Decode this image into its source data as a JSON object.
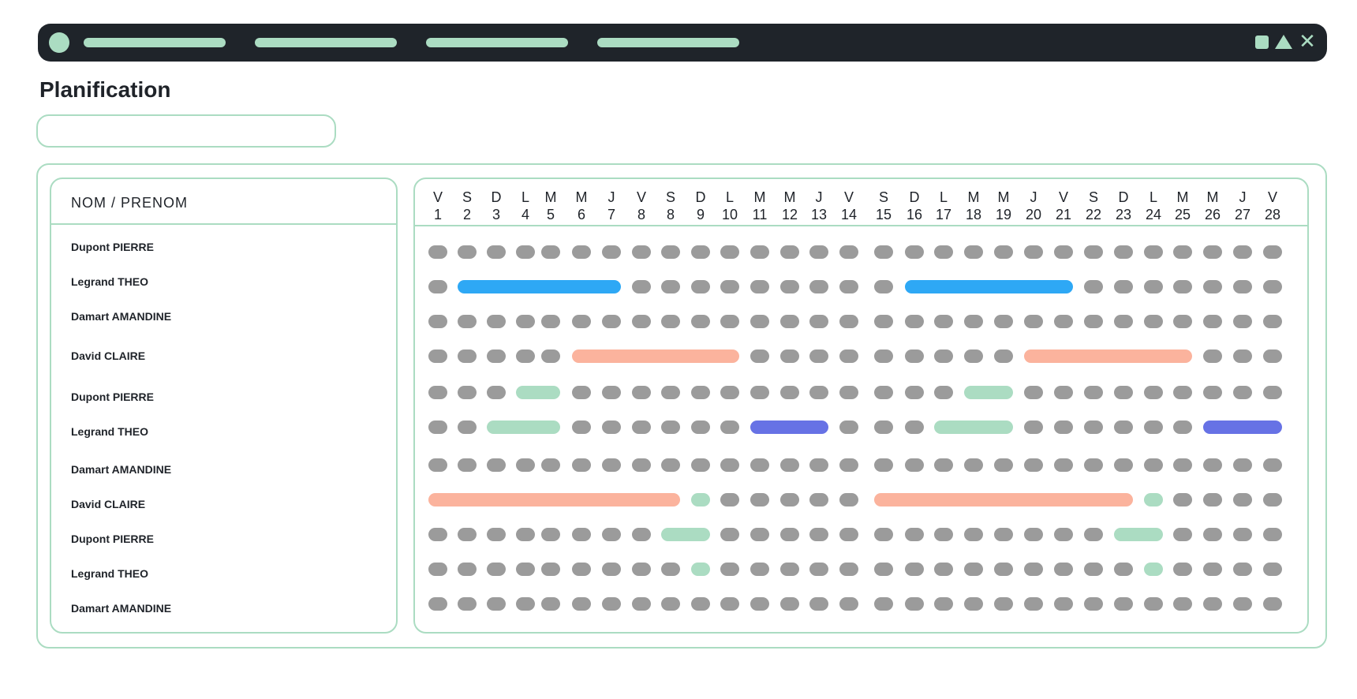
{
  "titlebar": {
    "nav_pill_count": 4,
    "accent": "#abdcc2",
    "background": "#1f242a",
    "icons": [
      "app-dot-icon",
      "square-icon",
      "triangle-icon",
      "close-icon"
    ],
    "close_glyph": "✕"
  },
  "page": {
    "title": "Planification"
  },
  "search": {
    "value": "",
    "placeholder": ""
  },
  "names_header": "NOM / PRENOM",
  "colors": {
    "empty": "#9b9b9b",
    "blue": "#2ea8f5",
    "salmon": "#fbb39d",
    "green": "#abdcc2",
    "indigo": "#6772e5"
  },
  "days": [
    {
      "letter": "V",
      "num": "1"
    },
    {
      "letter": "S",
      "num": "2"
    },
    {
      "letter": "D",
      "num": "3"
    },
    {
      "letter": "L",
      "num": "4"
    },
    {
      "letter": "M",
      "num": "5"
    },
    {
      "letter": "M",
      "num": "6"
    },
    {
      "letter": "J",
      "num": "7"
    },
    {
      "letter": "V",
      "num": "8"
    },
    {
      "letter": "S",
      "num": "8"
    },
    {
      "letter": "D",
      "num": "9"
    },
    {
      "letter": "L",
      "num": "10"
    },
    {
      "letter": "M",
      "num": "11"
    },
    {
      "letter": "M",
      "num": "12"
    },
    {
      "letter": "J",
      "num": "13"
    },
    {
      "letter": "V",
      "num": "14"
    },
    {
      "letter": "S",
      "num": "15"
    },
    {
      "letter": "D",
      "num": "16"
    },
    {
      "letter": "L",
      "num": "17"
    },
    {
      "letter": "M",
      "num": "18"
    },
    {
      "letter": "M",
      "num": "19"
    },
    {
      "letter": "J",
      "num": "20"
    },
    {
      "letter": "V",
      "num": "21"
    },
    {
      "letter": "S",
      "num": "22"
    },
    {
      "letter": "D",
      "num": "23"
    },
    {
      "letter": "L",
      "num": "24"
    },
    {
      "letter": "M",
      "num": "25"
    },
    {
      "letter": "M",
      "num": "26"
    },
    {
      "letter": "J",
      "num": "27"
    },
    {
      "letter": "V",
      "num": "28"
    }
  ],
  "rows": [
    {
      "name": "Dupont PIERRE",
      "bars": []
    },
    {
      "name": "Legrand THEO",
      "bars": [
        {
          "from": 1,
          "to": 6,
          "color": "blue"
        },
        {
          "from": 16,
          "to": 21,
          "color": "blue"
        }
      ]
    },
    {
      "name": "Damart AMANDINE",
      "bars": []
    },
    {
      "name": "David CLAIRE",
      "bars": [
        {
          "from": 5,
          "to": 10,
          "color": "salmon"
        },
        {
          "from": 20,
          "to": 25,
          "color": "salmon"
        }
      ]
    },
    {
      "name": "Dupont PIERRE",
      "bars": [
        {
          "from": 3,
          "to": 4,
          "color": "green"
        },
        {
          "from": 18,
          "to": 19,
          "color": "green"
        }
      ]
    },
    {
      "name": "Legrand THEO",
      "bars": [
        {
          "from": 2,
          "to": 4,
          "color": "green"
        },
        {
          "from": 11,
          "to": 13,
          "color": "indigo"
        },
        {
          "from": 17,
          "to": 19,
          "color": "green"
        },
        {
          "from": 26,
          "to": 28,
          "color": "indigo"
        }
      ]
    },
    {
      "name": "Damart AMANDINE",
      "bars": []
    },
    {
      "name": "David CLAIRE",
      "bars": [
        {
          "from": 0,
          "to": 8,
          "color": "salmon"
        },
        {
          "from": 9,
          "to": 9,
          "color": "green"
        },
        {
          "from": 15,
          "to": 23,
          "color": "salmon"
        },
        {
          "from": 24,
          "to": 24,
          "color": "green"
        }
      ]
    },
    {
      "name": "Dupont PIERRE",
      "bars": [
        {
          "from": 8,
          "to": 9,
          "color": "green"
        },
        {
          "from": 23,
          "to": 24,
          "color": "green"
        }
      ]
    },
    {
      "name": "Legrand THEO",
      "bars": [
        {
          "from": 9,
          "to": 9,
          "color": "green"
        },
        {
          "from": 24,
          "to": 24,
          "color": "green"
        }
      ]
    },
    {
      "name": "Damart AMANDINE",
      "bars": []
    }
  ]
}
